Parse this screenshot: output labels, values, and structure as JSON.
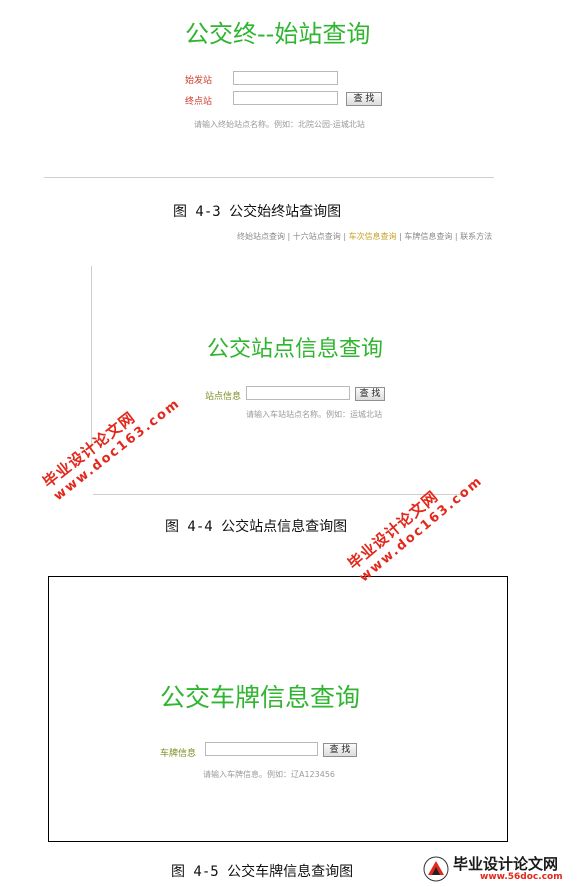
{
  "fig3": {
    "title": "公交终--始站查询",
    "start_label": "始发站",
    "end_label": "终点站",
    "button": "查 找",
    "hint": "请输入终始站点名称。例如：北院公园-运城北站",
    "caption": "图 4-3   公交始终站查询图"
  },
  "fig4": {
    "nav": [
      {
        "label": "终始站点查询"
      },
      {
        "label": "十六站点查询"
      },
      {
        "label": "车次信息查询"
      },
      {
        "label": "车牌信息查询"
      },
      {
        "label": "联系方法"
      }
    ],
    "title": "公交站点信息查询",
    "label": "站点信息",
    "button": "查 找",
    "hint": "请输入车站站点名称。例如：运城北站",
    "caption": "图 4-4   公交站点信息查询图"
  },
  "fig5": {
    "title": "公交车牌信息查询",
    "label": "车牌信息",
    "button": "查 找",
    "hint": "请输入车牌信息。例如：辽A123456",
    "caption": "图 4-5  公交车牌信息查询图"
  },
  "watermarks": {
    "cn": "毕业设计论文网",
    "url": "www.doc163.com"
  },
  "logo": {
    "cn": "毕业设计论文网",
    "url": "www.56doc.com"
  },
  "colors": {
    "title_green": "#2fb52f",
    "watermark_red": "#e3281b",
    "label_red": "#d23a2a",
    "label_olive": "#7e8a1e"
  }
}
